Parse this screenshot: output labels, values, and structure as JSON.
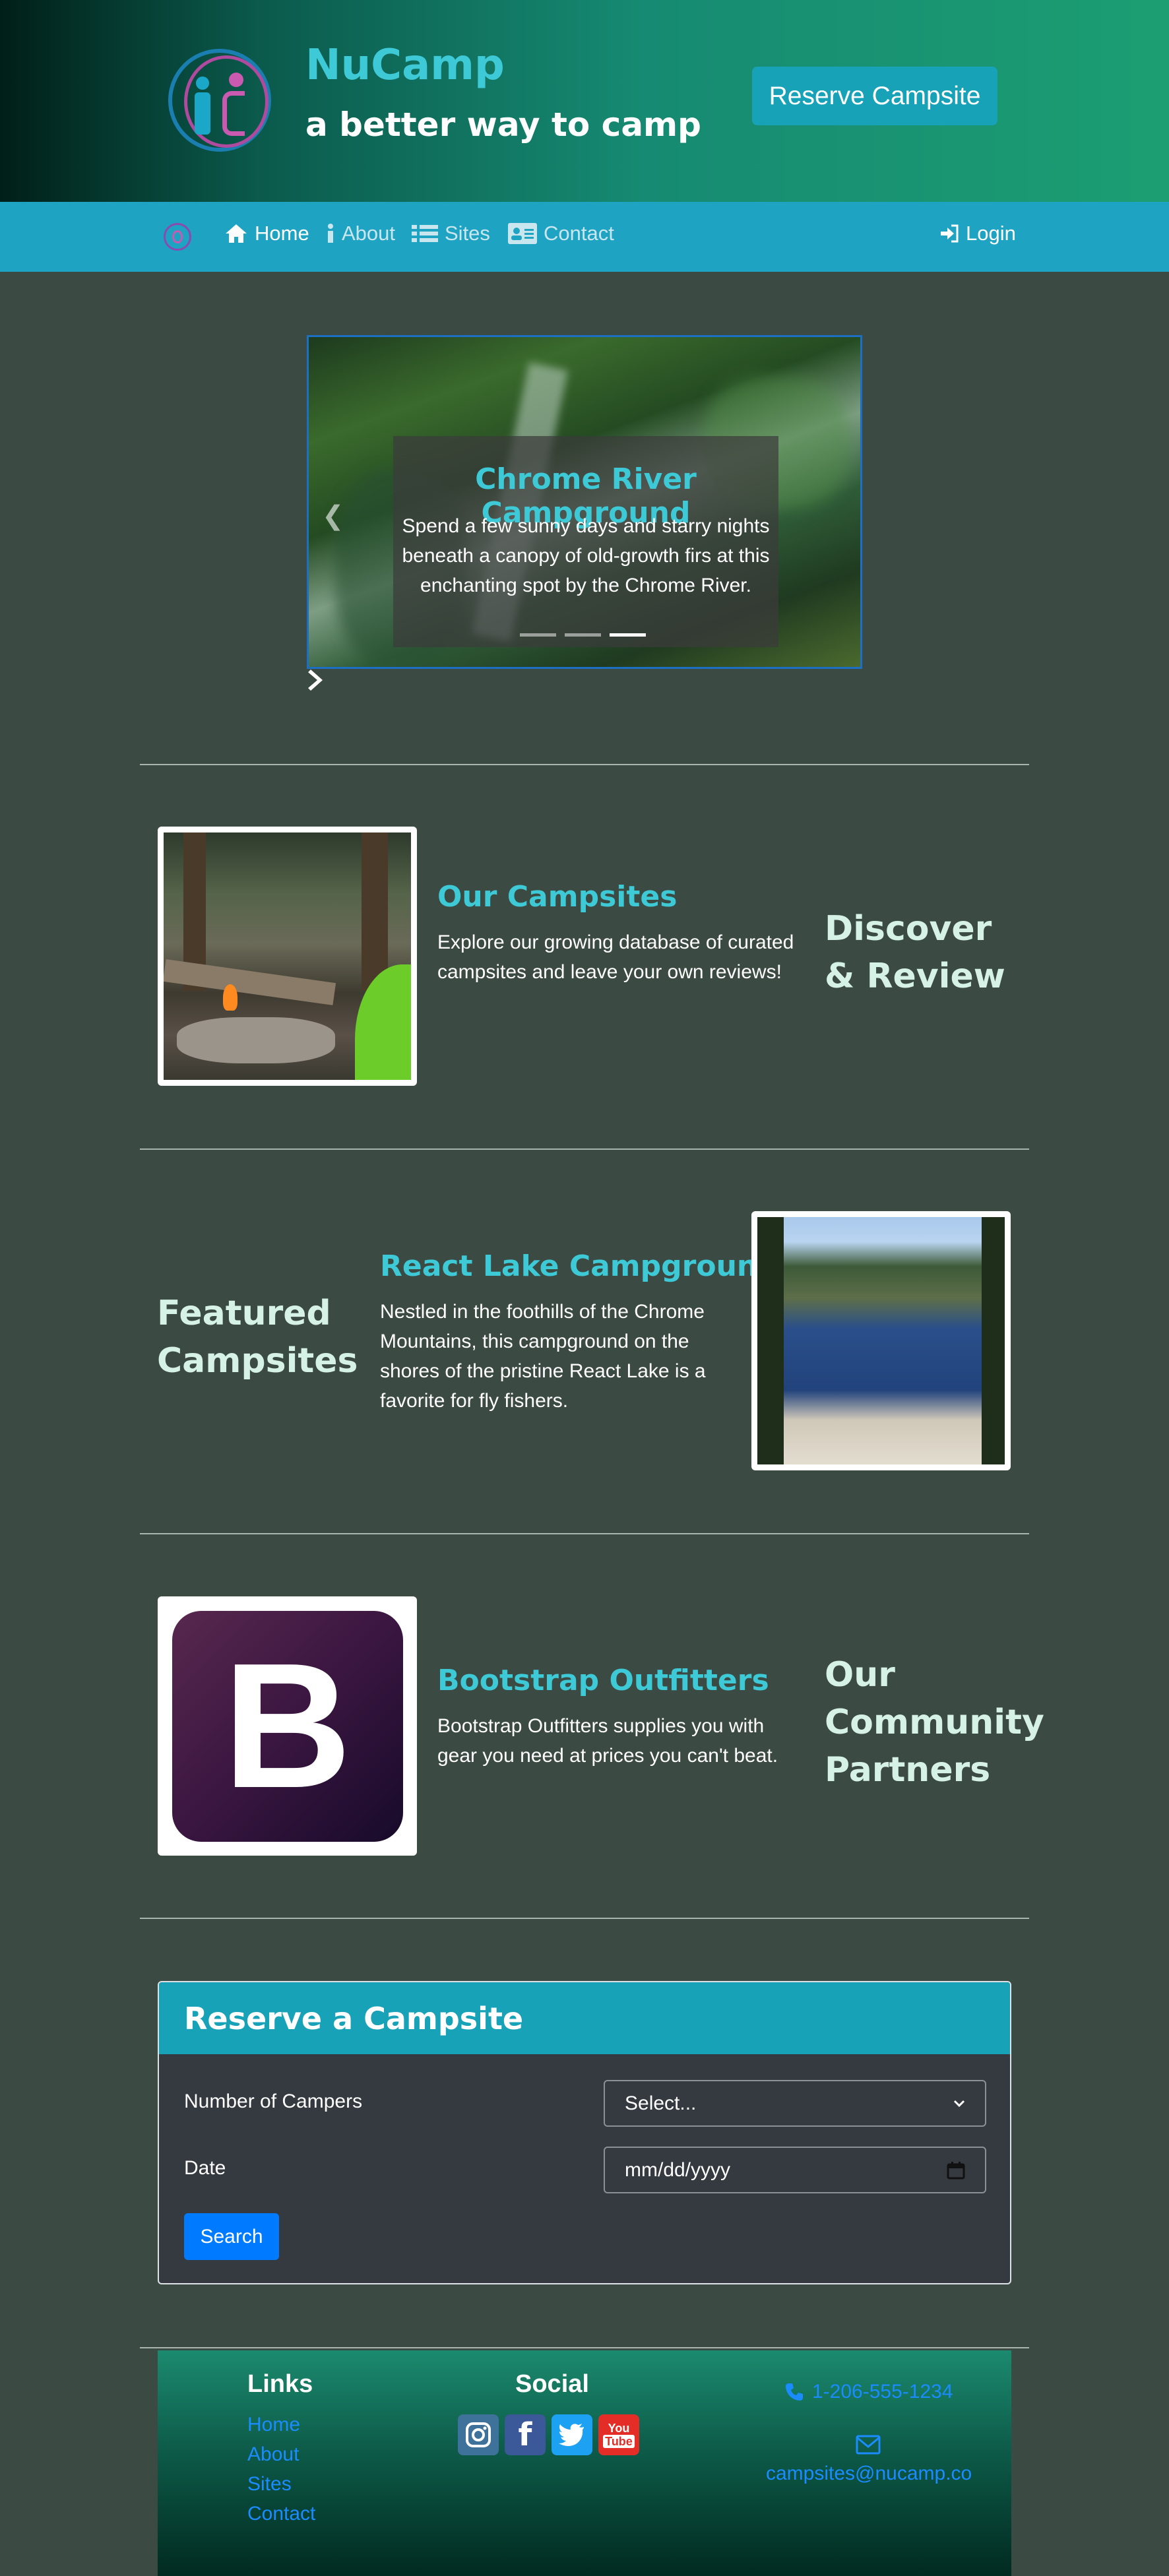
{
  "header": {
    "brand_title": "NuCamp",
    "brand_tagline": "a better way to camp",
    "reserve_button": "Reserve Campsite"
  },
  "navbar": {
    "items": [
      {
        "label": "Home",
        "icon": "home-icon",
        "active": true
      },
      {
        "label": "About",
        "icon": "info-icon",
        "active": false
      },
      {
        "label": "Sites",
        "icon": "list-icon",
        "active": false
      },
      {
        "label": "Contact",
        "icon": "address-card-icon",
        "active": false
      }
    ],
    "login": "Login"
  },
  "carousel": {
    "title": "Chrome River Campground",
    "text": "Spend a few sunny days and starry nights beneath a canopy of old-growth firs at this enchanting spot by the Chrome River.",
    "slides": 3,
    "active_slide": 3
  },
  "sections": {
    "campsites": {
      "title": "Our Campsites",
      "text": "Explore our growing database of curated campsites and leave your own reviews!",
      "side_label": "Discover & Review"
    },
    "featured": {
      "side_label": "Featured Campsites",
      "title": "React Lake Campground",
      "text": "Nestled in the foothills of the Chrome Mountains, this campground on the shores of the pristine React Lake is a favorite for fly fishers."
    },
    "partners": {
      "logo_letter": "B",
      "title": "Bootstrap Outfitters",
      "text": "Bootstrap Outfitters supplies you with gear you need at prices you can't beat.",
      "side_label": "Our Community Partners"
    }
  },
  "reserve_form": {
    "title": "Reserve a Campsite",
    "campers_label": "Number of Campers",
    "campers_value": "Select...",
    "date_label": "Date",
    "date_value": "mm/dd/yyyy",
    "search_button": "Search"
  },
  "footer": {
    "links_heading": "Links",
    "links": [
      "Home",
      "About",
      "Sites",
      "Contact"
    ],
    "social_heading": "Social",
    "social": [
      "instagram-icon",
      "facebook-icon",
      "twitter-icon",
      "youtube-icon"
    ],
    "phone": "1-206-555-1234",
    "email": "campsites@nucamp.co"
  },
  "colors": {
    "navbar": "#1ea3c3",
    "accent": "#3ec9d6",
    "card_header": "#17a2b8",
    "primary_button": "#007bff",
    "page_bg": "#3b4a42"
  }
}
